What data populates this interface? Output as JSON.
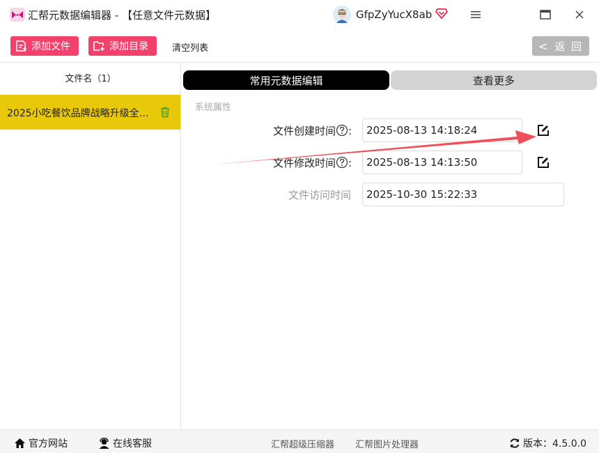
{
  "app": {
    "title": "汇帮元数据编辑器 - 【任意文件元数据】",
    "user_name": "GfpZyYucX8ab"
  },
  "toolbar": {
    "add_file": "添加文件",
    "add_dir": "添加目录",
    "clear_list": "清空列表",
    "back": "返 回"
  },
  "file_list": {
    "header": "文件名（1）",
    "items": [
      {
        "name": "2025小吃餐饮品牌战略升级全案..."
      }
    ]
  },
  "tabs": {
    "common": "常用元数据编辑",
    "more": "查看更多"
  },
  "section": {
    "title": "系统属性"
  },
  "fields": {
    "created": {
      "label": "文件创建时间",
      "value": "2025-08-13 14:18:24"
    },
    "modified": {
      "label": "文件修改时间",
      "value": "2025-08-13 14:13:50"
    },
    "accessed": {
      "label": "文件访问时间",
      "value": "2025-10-30 15:22:33"
    }
  },
  "footer": {
    "website": "官方网站",
    "support": "在线客服",
    "link_compress": "汇帮超级压缩器",
    "link_image": "汇帮图片处理器",
    "version": "版本：4.5.0.0"
  },
  "colors": {
    "accent_pink": "#f2426b",
    "selected_row": "#e8c90a",
    "annotation_arrow": "#f04e5a"
  }
}
